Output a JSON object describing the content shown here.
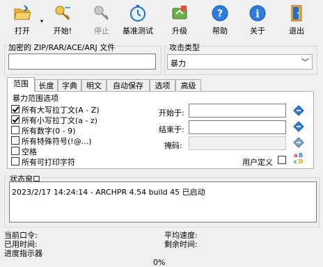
{
  "toolbar": {
    "open": "打开",
    "start": "开始!",
    "stop": "停止",
    "benchmark": "基准测试",
    "upgrade": "升级",
    "help": "帮助",
    "about": "关于",
    "exit": "退出"
  },
  "archive_group": {
    "title": "加密的 ZIP/RAR/ACE/ARJ 文件",
    "path_value": ""
  },
  "attack_group": {
    "title": "攻击类型",
    "selected": "暴力"
  },
  "tabs": [
    "范围",
    "长度",
    "字典",
    "明文",
    "自动保存",
    "选项",
    "高级"
  ],
  "range_panel": {
    "title": "暴力范围选项",
    "options": [
      {
        "label": "所有大写拉丁文(A - Z)",
        "checked": true
      },
      {
        "label": "所有小写拉丁文(a - z)",
        "checked": true
      },
      {
        "label": "所有数字(0 - 9)",
        "checked": false
      },
      {
        "label": "所有特殊符号(!@...)",
        "checked": false
      },
      {
        "label": "空格",
        "checked": false
      },
      {
        "label": "所有可打印字符",
        "checked": false
      }
    ],
    "start_label": "开始于:",
    "start_value": "",
    "end_label": "结束于:",
    "end_value": "",
    "mask_label": "掩码:",
    "mask_value": "",
    "user_defined_label": "用户定义",
    "user_defined_checked": false
  },
  "status": {
    "title": "状态窗口",
    "log": "2023/2/17 14:24:14 - ARCHPR 4.54 build 45 已启动"
  },
  "info": {
    "current_password": "当前口令:",
    "elapsed_time": "已用时间:",
    "progress_indicator": "进度指示器",
    "avg_speed": "平均速度:",
    "remaining_time": "剩余时间:"
  },
  "progress": {
    "value": 0,
    "text": "0%"
  },
  "colors": {
    "accent_blue": "#1f6fd0",
    "background": "#f0f0f0",
    "border": "#adadad"
  }
}
